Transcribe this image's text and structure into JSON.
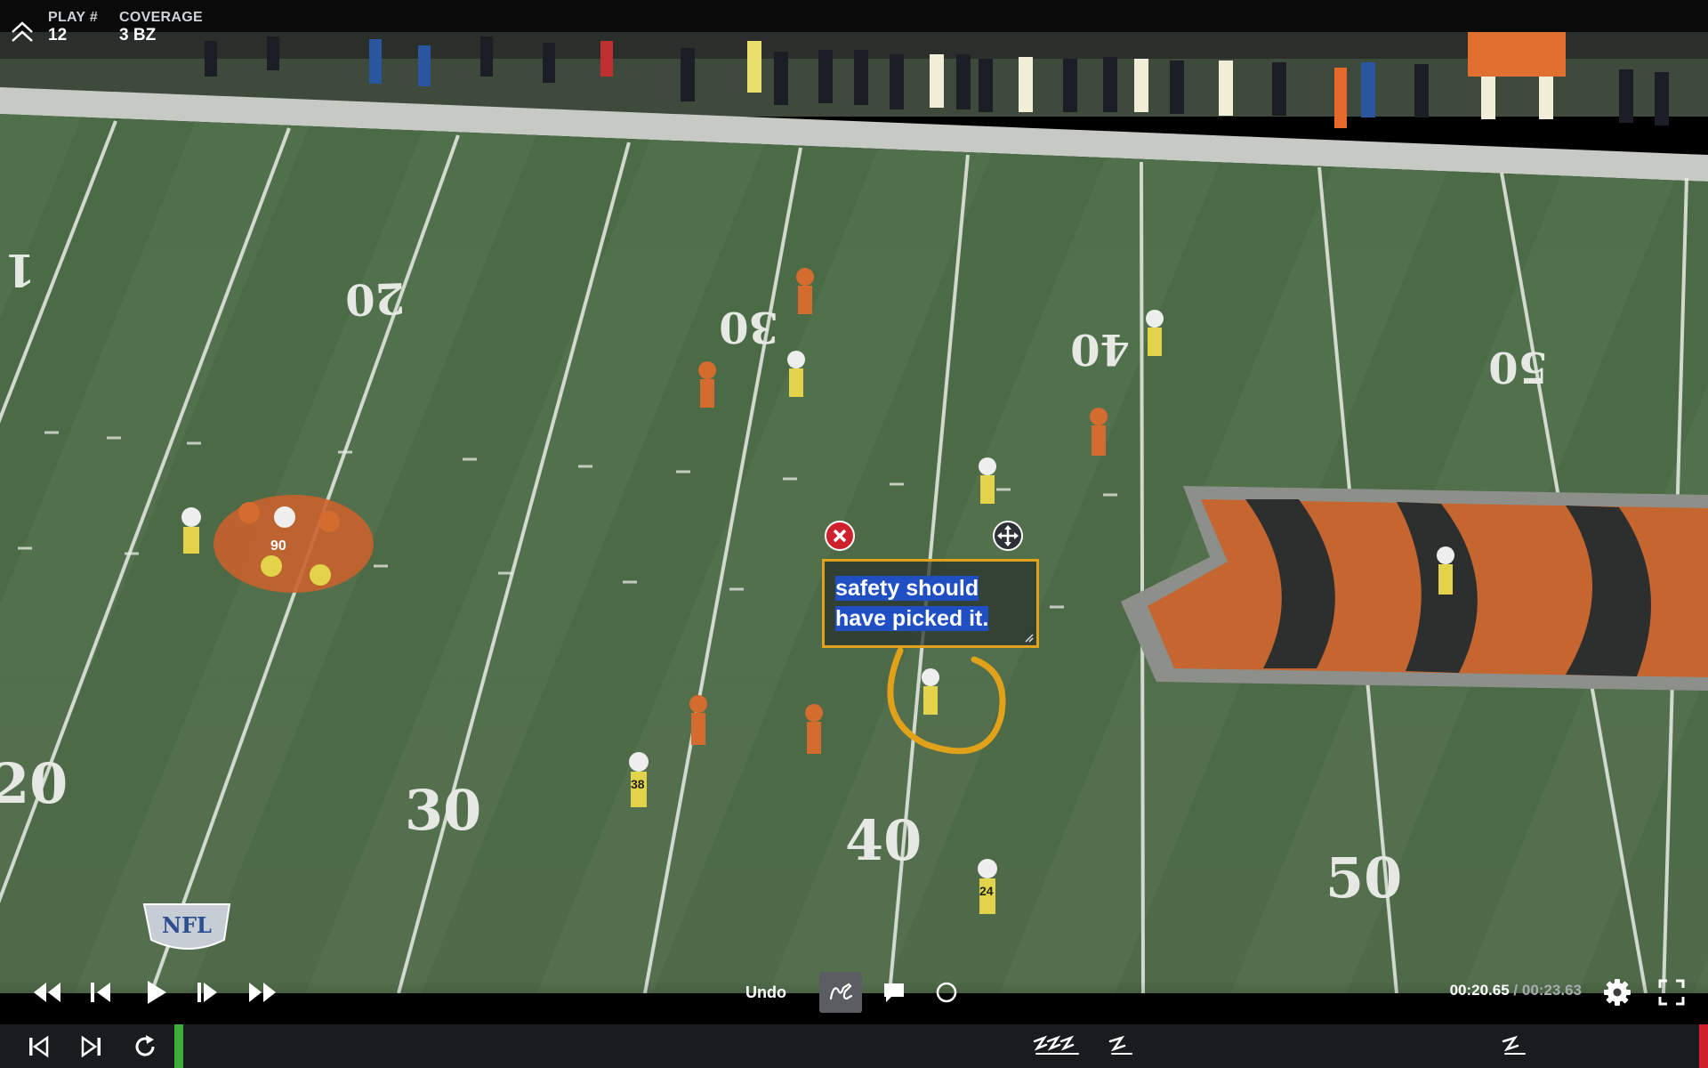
{
  "header": {
    "play_label": "PLAY #",
    "play_value": "12",
    "coverage_label": "COVERAGE",
    "coverage_value": "3 BZ"
  },
  "field": {
    "yard_numbers_far": [
      "1",
      "20",
      "30",
      "40",
      "50"
    ],
    "yard_numbers_near": [
      "20",
      "30",
      "40",
      "50"
    ],
    "logo_text": "NFL",
    "jersey_numbers": [
      "90",
      "38",
      "24"
    ]
  },
  "annotation": {
    "text_line1": "safety should",
    "text_line2": "have picked it.",
    "border_color": "#e1a21a",
    "highlight_color": "#1f4fc2"
  },
  "controls": {
    "undo_label": "Undo",
    "time_current": "00:20.65",
    "time_separator": " / ",
    "time_total": "00:23.63",
    "icons": [
      "rewind-icon",
      "step-back-icon",
      "play-icon",
      "step-forward-icon",
      "fast-forward-icon",
      "draw-icon",
      "comment-icon",
      "circle-icon",
      "gear-icon",
      "fullscreen-icon"
    ]
  },
  "bottombar": {
    "icons": [
      "skip-start-icon",
      "skip-end-icon",
      "replay-icon"
    ],
    "marker_icon": "scribble-marker-icon",
    "colors": {
      "start": "#3eae3a",
      "end": "#d0202c"
    }
  }
}
